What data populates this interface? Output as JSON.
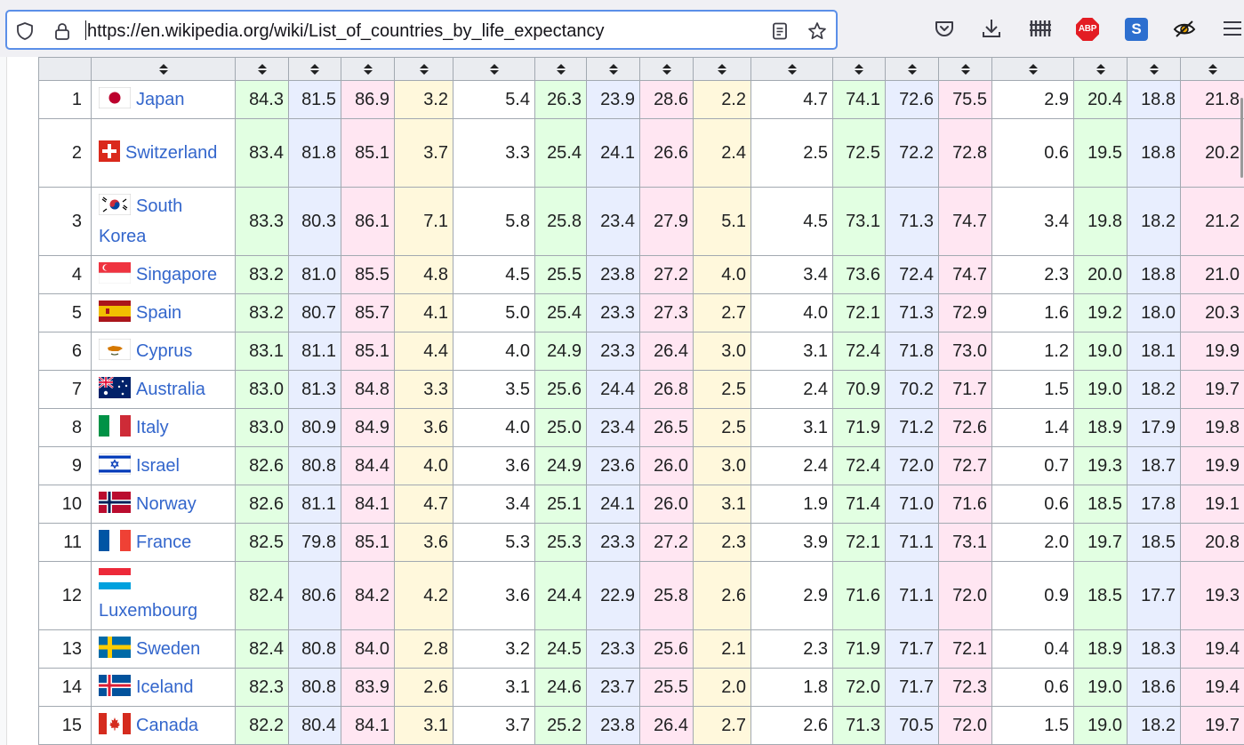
{
  "browser": {
    "url_prefix": "https://",
    "url_host": "en.wikipedia.org",
    "url_path": "/wiki/List_of_countries_by_life_expectancy",
    "icons": [
      "shield-icon",
      "lock-icon",
      "reader-view-icon",
      "bookmark-star-icon",
      "pocket-icon",
      "download-icon",
      "library-icon",
      "adblock-icon",
      "s-extension-icon",
      "eye-extension-icon",
      "menu-icon"
    ],
    "abp_label": "ABP",
    "s_label": "S"
  },
  "colors": {
    "accent": "#5b8fe8",
    "link": "#3366cc",
    "green_cell": "#e2ffe2",
    "blue_cell": "#e8eefe",
    "pink_cell": "#ffe6f2",
    "yellow_cell": "#fff8dc",
    "header_bg": "#eaecf0"
  },
  "table": {
    "column_count": 21,
    "rows": [
      {
        "rank": "1",
        "country": "Japan",
        "flag": "japan-flag-icon",
        "values": [
          "84.3",
          "81.5",
          "86.9",
          "3.2",
          "5.4",
          "26.3",
          "23.9",
          "28.6",
          "2.2",
          "4.7",
          "74.1",
          "72.6",
          "75.5",
          "2.9",
          "20.4",
          "18.8",
          "21.8"
        ]
      },
      {
        "rank": "2",
        "country": "Switzerland",
        "flag": "switzerland-flag-icon",
        "values": [
          "83.4",
          "81.8",
          "85.1",
          "3.7",
          "3.3",
          "25.4",
          "24.1",
          "26.6",
          "2.4",
          "2.5",
          "72.5",
          "72.2",
          "72.8",
          "0.6",
          "19.5",
          "18.8",
          "20.2"
        ]
      },
      {
        "rank": "3",
        "country": "South Korea",
        "flag": "south-korea-flag-icon",
        "values": [
          "83.3",
          "80.3",
          "86.1",
          "7.1",
          "5.8",
          "25.8",
          "23.4",
          "27.9",
          "5.1",
          "4.5",
          "73.1",
          "71.3",
          "74.7",
          "3.4",
          "19.8",
          "18.2",
          "21.2"
        ]
      },
      {
        "rank": "4",
        "country": "Singapore",
        "flag": "singapore-flag-icon",
        "values": [
          "83.2",
          "81.0",
          "85.5",
          "4.8",
          "4.5",
          "25.5",
          "23.8",
          "27.2",
          "4.0",
          "3.4",
          "73.6",
          "72.4",
          "74.7",
          "2.3",
          "20.0",
          "18.8",
          "21.0"
        ]
      },
      {
        "rank": "5",
        "country": "Spain",
        "flag": "spain-flag-icon",
        "values": [
          "83.2",
          "80.7",
          "85.7",
          "4.1",
          "5.0",
          "25.4",
          "23.3",
          "27.3",
          "2.7",
          "4.0",
          "72.1",
          "71.3",
          "72.9",
          "1.6",
          "19.2",
          "18.0",
          "20.3"
        ]
      },
      {
        "rank": "6",
        "country": "Cyprus",
        "flag": "cyprus-flag-icon",
        "values": [
          "83.1",
          "81.1",
          "85.1",
          "4.4",
          "4.0",
          "24.9",
          "23.3",
          "26.4",
          "3.0",
          "3.1",
          "72.4",
          "71.8",
          "73.0",
          "1.2",
          "19.0",
          "18.1",
          "19.9"
        ]
      },
      {
        "rank": "7",
        "country": "Australia",
        "flag": "australia-flag-icon",
        "values": [
          "83.0",
          "81.3",
          "84.8",
          "3.3",
          "3.5",
          "25.6",
          "24.4",
          "26.8",
          "2.5",
          "2.4",
          "70.9",
          "70.2",
          "71.7",
          "1.5",
          "19.0",
          "18.2",
          "19.7"
        ]
      },
      {
        "rank": "8",
        "country": "Italy",
        "flag": "italy-flag-icon",
        "values": [
          "83.0",
          "80.9",
          "84.9",
          "3.6",
          "4.0",
          "25.0",
          "23.4",
          "26.5",
          "2.5",
          "3.1",
          "71.9",
          "71.2",
          "72.6",
          "1.4",
          "18.9",
          "17.9",
          "19.8"
        ]
      },
      {
        "rank": "9",
        "country": "Israel",
        "flag": "israel-flag-icon",
        "values": [
          "82.6",
          "80.8",
          "84.4",
          "4.0",
          "3.6",
          "24.9",
          "23.6",
          "26.0",
          "3.0",
          "2.4",
          "72.4",
          "72.0",
          "72.7",
          "0.7",
          "19.3",
          "18.7",
          "19.9"
        ]
      },
      {
        "rank": "10",
        "country": "Norway",
        "flag": "norway-flag-icon",
        "values": [
          "82.6",
          "81.1",
          "84.1",
          "4.7",
          "3.4",
          "25.1",
          "24.1",
          "26.0",
          "3.1",
          "1.9",
          "71.4",
          "71.0",
          "71.6",
          "0.6",
          "18.5",
          "17.8",
          "19.1"
        ]
      },
      {
        "rank": "11",
        "country": "France",
        "flag": "france-flag-icon",
        "values": [
          "82.5",
          "79.8",
          "85.1",
          "3.6",
          "5.3",
          "25.3",
          "23.3",
          "27.2",
          "2.3",
          "3.9",
          "72.1",
          "71.1",
          "73.1",
          "2.0",
          "19.7",
          "18.5",
          "20.8"
        ]
      },
      {
        "rank": "12",
        "country": "Luxembourg",
        "flag": "luxembourg-flag-icon",
        "values": [
          "82.4",
          "80.6",
          "84.2",
          "4.2",
          "3.6",
          "24.4",
          "22.9",
          "25.8",
          "2.6",
          "2.9",
          "71.6",
          "71.1",
          "72.0",
          "0.9",
          "18.5",
          "17.7",
          "19.3"
        ]
      },
      {
        "rank": "13",
        "country": "Sweden",
        "flag": "sweden-flag-icon",
        "values": [
          "82.4",
          "80.8",
          "84.0",
          "2.8",
          "3.2",
          "24.5",
          "23.3",
          "25.6",
          "2.1",
          "2.3",
          "71.9",
          "71.7",
          "72.1",
          "0.4",
          "18.9",
          "18.3",
          "19.4"
        ]
      },
      {
        "rank": "14",
        "country": "Iceland",
        "flag": "iceland-flag-icon",
        "values": [
          "82.3",
          "80.8",
          "83.9",
          "2.6",
          "3.1",
          "24.6",
          "23.7",
          "25.5",
          "2.0",
          "1.8",
          "72.0",
          "71.7",
          "72.3",
          "0.6",
          "19.0",
          "18.6",
          "19.4"
        ]
      },
      {
        "rank": "15",
        "country": "Canada",
        "flag": "canada-flag-icon",
        "values": [
          "82.2",
          "80.4",
          "84.1",
          "3.1",
          "3.7",
          "25.2",
          "23.8",
          "26.4",
          "2.7",
          "2.6",
          "71.3",
          "70.5",
          "72.0",
          "1.5",
          "19.0",
          "18.2",
          "19.7"
        ]
      }
    ]
  }
}
